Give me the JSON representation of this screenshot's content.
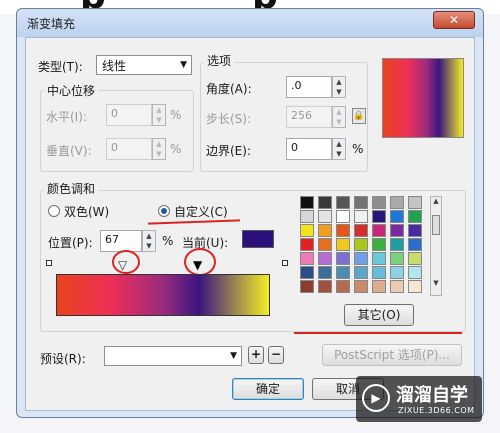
{
  "dialog": {
    "title": "渐变填充",
    "close_glyph": "✕"
  },
  "type": {
    "label": "类型(T):",
    "value": "线性"
  },
  "center_offset": {
    "title": "中心位移",
    "horizontal_label": "水平(I):",
    "horizontal_value": "0",
    "vertical_label": "垂直(V):",
    "vertical_value": "0",
    "unit": "%"
  },
  "options": {
    "title": "选项",
    "angle_label": "角度(A):",
    "angle_value": ".0",
    "steps_label": "步长(S):",
    "steps_value": "256",
    "edge_label": "边界(E):",
    "edge_value": "0",
    "unit": "%"
  },
  "color_blend": {
    "title": "颜色调和",
    "two_color_label": "双色(W)",
    "custom_label": "自定义(C)",
    "selected": "custom",
    "position_label": "位置(P):",
    "position_value": "67",
    "position_unit": "%",
    "current_label": "当前(U):",
    "current_color": "#2b0f7c",
    "gradient_stops": [
      "#e8431c",
      "#ef2f57",
      "#9a2b7e",
      "#3a1580",
      "#f4ee24"
    ],
    "selected_stop_percent": 67
  },
  "palette": {
    "colors": [
      "#111111",
      "#3a3a3a",
      "#565656",
      "#737373",
      "#8e8e8e",
      "#a9a9a9",
      "#c4c4c4",
      "#d6d6d6",
      "#e4e4e4",
      "#ffffff",
      "#f0f0f0",
      "#23177a",
      "#1e78d6",
      "#1ea34e",
      "#f2e21a",
      "#f0a01e",
      "#e8551c",
      "#d62c2c",
      "#c82878",
      "#7a2c9c",
      "#4a2ca0",
      "#e22222",
      "#e86e1e",
      "#efc81e",
      "#a8c81e",
      "#3cb03c",
      "#1ea0a0",
      "#2a6cc8",
      "#ec7ab4",
      "#b46ed2",
      "#7c6ed2",
      "#6ea0e6",
      "#66c8d8",
      "#7cd27c",
      "#c8dc6e",
      "#2e4c8c",
      "#3c6e9c",
      "#4c8cb4",
      "#5aa8c8",
      "#68bcd8",
      "#8cd2e4",
      "#b4e6f0",
      "#8c3c2c",
      "#a0503c",
      "#b46c50",
      "#c88c6c",
      "#dcac8c",
      "#ecccb0",
      "#f6e6d2"
    ],
    "other_button": "其它(O)"
  },
  "presets": {
    "label": "预设(R):",
    "value": "",
    "postscript_button": "PostScript 选项(P)..."
  },
  "footer": {
    "ok_button": "确定",
    "cancel_button": "取消"
  },
  "watermark": {
    "brand": "溜溜自学",
    "url": "ZIXUE.3D66.COM"
  }
}
